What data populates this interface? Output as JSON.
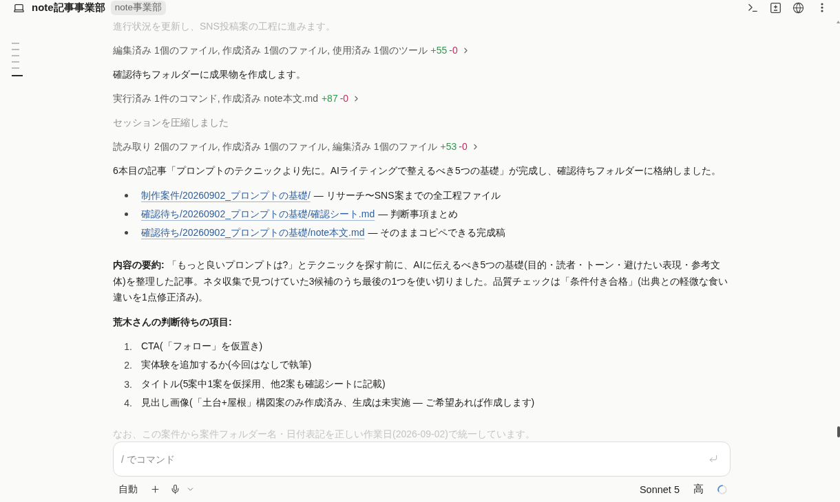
{
  "header": {
    "title": "note記事事業部",
    "badge": "note事業部"
  },
  "outline_markers": [
    {
      "selected": false
    },
    {
      "selected": false
    },
    {
      "selected": false
    },
    {
      "selected": false
    },
    {
      "selected": false
    },
    {
      "selected": true
    }
  ],
  "messages": [
    {
      "kind": "faded",
      "text": "進行状況を更新し、SNS投稿案の工程に進みます。"
    },
    {
      "kind": "tool_summary",
      "text": "編集済み 1個のファイル, 作成済み 1個のファイル, 使用済み 1個のツール",
      "added": "+55",
      "removed": "-0"
    },
    {
      "kind": "text",
      "text": "確認待ちフォルダーに成果物を作成します。"
    },
    {
      "kind": "tool_summary",
      "text": "実行済み 1件のコマンド, 作成済み note本文.md",
      "added": "+87",
      "removed": "-0"
    },
    {
      "kind": "notice",
      "text": "セッションを圧縮しました"
    },
    {
      "kind": "tool_summary",
      "text": "読み取り 2個のファイル, 作成済み 1個のファイル, 編集済み 1個のファイル",
      "added": "+53",
      "removed": "-0"
    },
    {
      "kind": "text",
      "text": "6本目の記事「プロンプトのテクニックより先に。AIライティングで整えるべき5つの基礎」が完成し、確認待ちフォルダーに格納しました。"
    },
    {
      "kind": "link_list",
      "items": [
        {
          "link": "制作案件/20260902_プロンプトの基礎/",
          "note": "— リサーチ〜SNS案までの全工程ファイル"
        },
        {
          "link": "確認待ち/20260902_プロンプトの基礎/確認シート.md",
          "note": "— 判断事項まとめ"
        },
        {
          "link": "確認待ち/20260902_プロンプトの基礎/note本文.md",
          "note": "— そのままコピペできる完成稿"
        }
      ]
    },
    {
      "kind": "paragraph",
      "text": "**内容の要約:** 「もっと良いプロンプトは?」とテクニックを探す前に、AIに伝えるべき5つの基礎(目的・読者・トーン・避けたい表現・参考文体)を整理した記事。ネタ収集で見つけていた3候補のうち最後の1つを使い切りました。品質チェックは「条件付き合格」(出典との軽微な食い違いを1点修正済み)。"
    },
    {
      "kind": "heading",
      "text": "荒木さんの判断待ちの項目:"
    },
    {
      "kind": "numbered_list",
      "items": [
        {
          "number": "1.",
          "text": "CTA(「フォロー」を仮置き)"
        },
        {
          "number": "2.",
          "text": "実体験を追加するか(今回はなしで執筆)"
        },
        {
          "number": "3.",
          "text": "タイトル(5案中1案を仮採用、他2案も確認シートに記載)"
        },
        {
          "number": "4.",
          "text": "見出し画像(「土台+屋根」構図案のみ作成済み、生成は未実施 — ご希望あれば作成します)"
        }
      ]
    },
    {
      "kind": "faded",
      "text": "なお、この案件から案件フォルダー名・日付表記を正しい作業日(2026-09-02)で統一しています。"
    }
  ],
  "composer": {
    "placeholder": "/ でコマンド"
  },
  "toolbar": {
    "mode": "自動",
    "model": "Sonnet 5",
    "effort": "高"
  }
}
